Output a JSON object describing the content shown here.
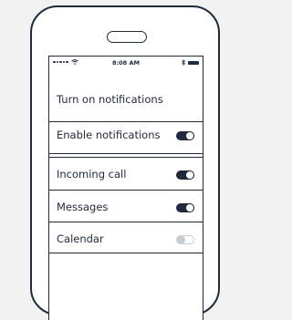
{
  "status_bar": {
    "time": "8:08 AM",
    "signal_icon": "signal-dots-icon",
    "wifi_icon": "wifi-icon",
    "bluetooth_icon": "bluetooth-icon",
    "battery_icon": "battery-icon"
  },
  "header": {
    "title": "Turn on notifications"
  },
  "settings": [
    {
      "label": "Enable notifications",
      "enabled": true
    },
    {
      "label": "Incoming call",
      "enabled": true
    },
    {
      "label": "Messages",
      "enabled": true
    },
    {
      "label": "Calendar",
      "enabled": false
    }
  ],
  "colors": {
    "ink": "#1f2a3a",
    "toggle_off": "#c8cdd3",
    "background": "#f2f2f2"
  }
}
